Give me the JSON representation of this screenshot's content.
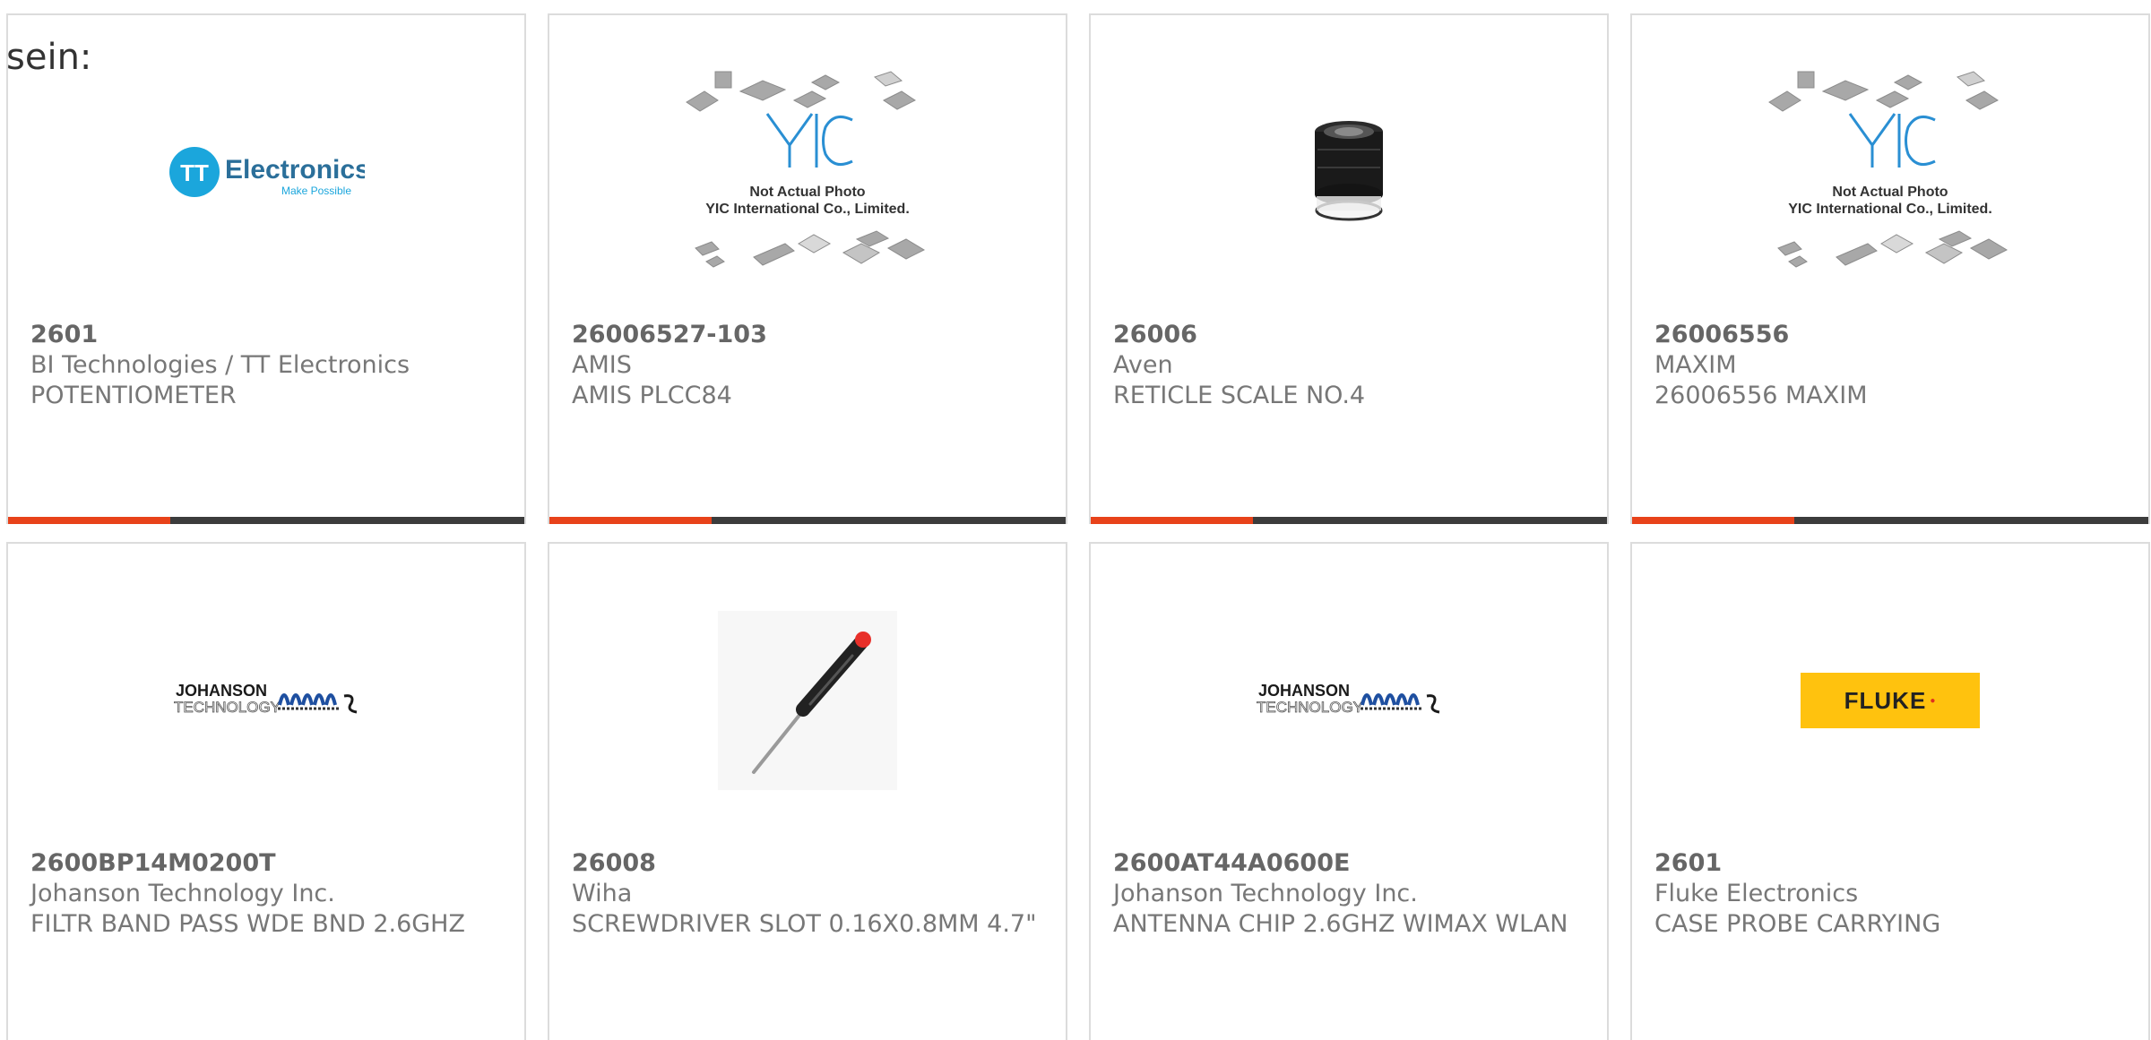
{
  "intro": {
    "text": "sein:"
  },
  "products": [
    {
      "part_number": "2601",
      "manufacturer": "BI Technologies / TT Electronics",
      "description": "POTENTIOMETER",
      "image": "tt-electronics-logo",
      "logo_text": "Electronics",
      "logo_tagline": "Make Possible",
      "logo_mark": "TT",
      "progress": 0.315
    },
    {
      "part_number": "26006527-103",
      "manufacturer": "AMIS",
      "description": "AMIS PLCC84",
      "image": "yic-placeholder",
      "placeholder_lines": [
        "Not Actual Photo",
        "YIC International Co., Limited."
      ],
      "progress": 0.315
    },
    {
      "part_number": "26006",
      "manufacturer": "Aven",
      "description": "RETICLE SCALE NO.4",
      "image": "magnifier-loupe-photo",
      "progress": 0.315
    },
    {
      "part_number": "26006556",
      "manufacturer": "MAXIM",
      "description": "26006556 MAXIM",
      "image": "yic-placeholder",
      "placeholder_lines": [
        "Not Actual Photo",
        "YIC International Co., Limited."
      ],
      "progress": 0.315
    },
    {
      "part_number": "2600BP14M0200T",
      "manufacturer": "Johanson Technology Inc.",
      "description": "FILTR BAND PASS WDE BND 2.6GHZ",
      "image": "johanson-logo",
      "logo_lines": [
        "JOHANSON",
        "TECHNOLOGY"
      ]
    },
    {
      "part_number": "26008",
      "manufacturer": "Wiha",
      "description": "SCREWDRIVER SLOT 0.16X0.8MM 4.7\"",
      "image": "screwdriver-photo"
    },
    {
      "part_number": "2600AT44A0600E",
      "manufacturer": "Johanson Technology Inc.",
      "description": "ANTENNA CHIP 2.6GHZ WIMAX WLAN",
      "image": "johanson-logo",
      "logo_lines": [
        "JOHANSON",
        "TECHNOLOGY"
      ]
    },
    {
      "part_number": "2601",
      "manufacturer": "Fluke Electronics",
      "description": "CASE PROBE CARRYING",
      "image": "fluke-logo",
      "logo_text": "FLUKE"
    }
  ],
  "colors": {
    "accent_orange": "#e8421a",
    "bar_dark": "#3c3c3c",
    "card_border": "#dcdcdc",
    "text_gray": "#777777",
    "tt_blue": "#1ba6dc",
    "fluke_yellow": "#ffc20e"
  }
}
